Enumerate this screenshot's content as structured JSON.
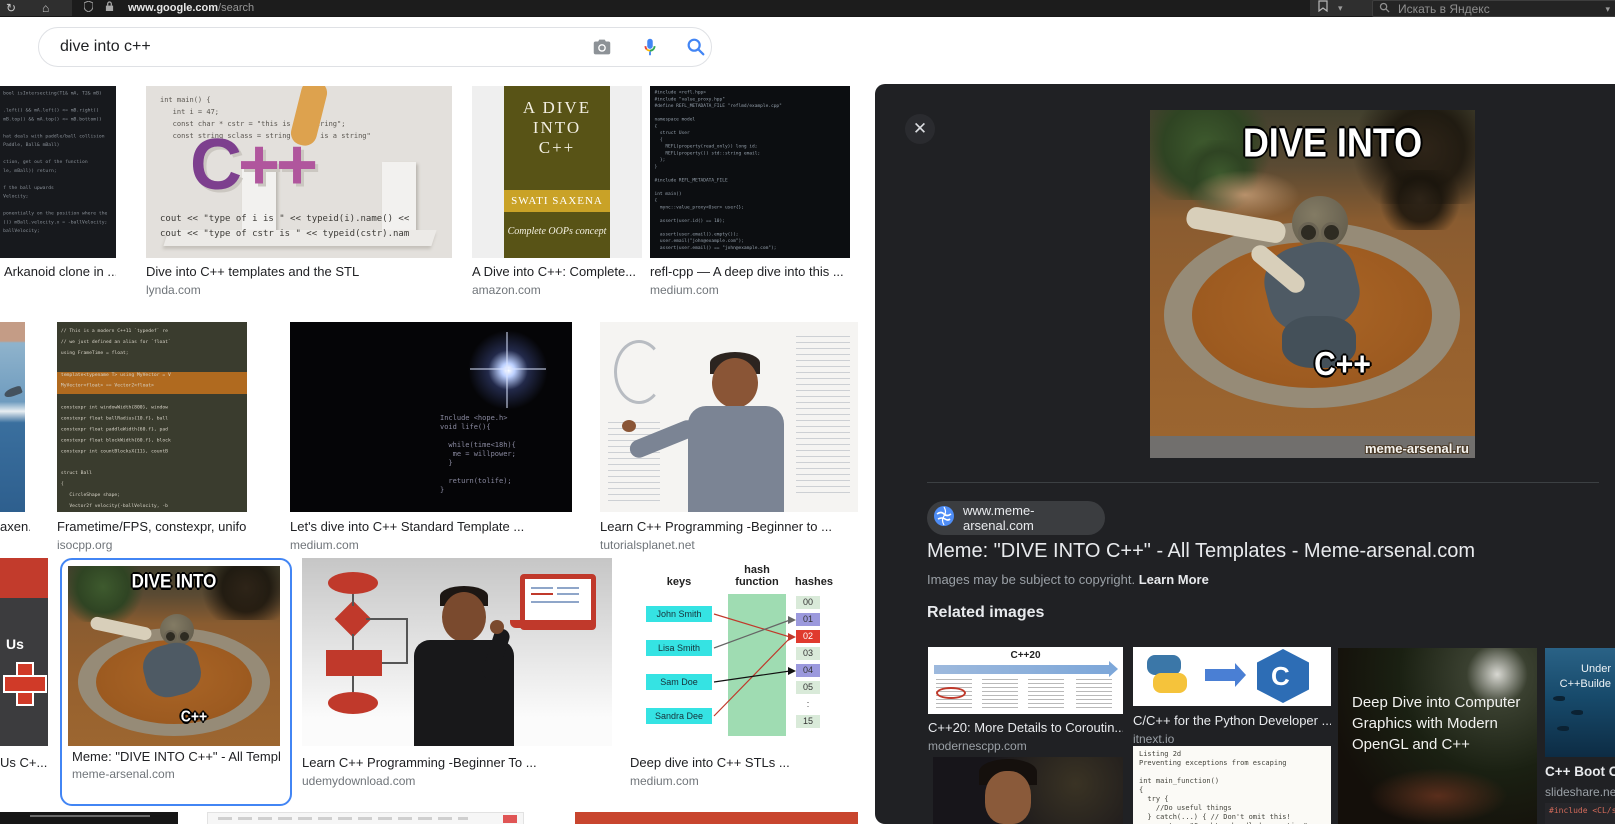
{
  "browser": {
    "url_host": "www.google.com",
    "url_path": "/search",
    "yandex_placeholder": "Искать в Яндекс"
  },
  "search": {
    "query": "dive into c++"
  },
  "results": [
    {
      "title": "Arkanoid clone in ...",
      "domain": ""
    },
    {
      "title": "Dive into C++ templates and the STL",
      "domain": "lynda.com"
    },
    {
      "title": "A Dive into C++: Complete...",
      "domain": "amazon.com"
    },
    {
      "title": "refl-cpp — A deep dive into this ...",
      "domain": "medium.com"
    },
    {
      "title": "axen...",
      "domain": ""
    },
    {
      "title": "Frametime/FPS, constexpr, uniform ...",
      "domain": "isocpp.org"
    },
    {
      "title": "Let's dive into C++ Standard Template ...",
      "domain": "medium.com"
    },
    {
      "title": "Learn C++ Programming -Beginner to ...",
      "domain": "tutorialsplanet.net"
    },
    {
      "title": "Us C+...",
      "domain": ""
    },
    {
      "title": "Meme: \"DIVE INTO C++\" - All Templat...",
      "domain": "meme-arsenal.com"
    },
    {
      "title": "Learn C++ Programming -Beginner To ...",
      "domain": "udemydownload.com"
    },
    {
      "title": "Deep dive into C++ STLs ...",
      "domain": "medium.com"
    }
  ],
  "thumbs": {
    "arkanoid_code": [
      "bool isIntersecting(T1& mA, T2& mB)",
      "",
      ".left() && mA.left() <= mB.right()",
      "mB.top() && mA.top() <= mB.bottom()",
      "",
      "hat deals with paddle/ball collision",
      "Paddle, Ball& mBall)",
      "",
      "ction, get out of the function",
      "le, mBall)) return;",
      "",
      "f the ball upwards",
      "Velocity;",
      "",
      "ponentially on the position where the",
      "()) mBall.velocity.x = -ballVelocity;",
      "ballVelocity;"
    ],
    "lynda": {
      "code_top": [
        "int main() {",
        "   int i = 47;",
        "   const char * cstr = \"this is a c-string\";",
        "   const string sclass = string(\"this is a string\""
      ],
      "big_text": "C",
      "big_plus": "++",
      "code_bottom": [
        "cout << \"type of i is \" << typeid(i).name() <<",
        "cout << \"type of cstr is \" << typeid(cstr).nam"
      ]
    },
    "book": {
      "title_line1": "A DIVE",
      "title_line2": "INTO",
      "title_line3": "C++",
      "author": "SWATI SAXENA",
      "tagline": "Complete OOPs concept"
    },
    "refl_code": [
      "#include <refl.hpp>",
      "#include \"value_proxy.hpp\"",
      "#define REFL_METADATA_FILE \"reflmd/example.cpp\"",
      "",
      "namespace model",
      "{",
      "  struct User",
      "  {",
      "    REFL(property(read_only)) long id;",
      "    REFL(property()) std::string email;",
      "  };",
      "}",
      "",
      "#include REFL_METADATA_FILE",
      "",
      "int main()",
      "{",
      "  mync::value_proxy<User> user{};",
      "",
      "  assert(user.id() == 10);",
      "",
      "  assert(user.email().empty());",
      "  user.email(\"john@example.com\");",
      "  assert(user.email() == \"john@example.com\");",
      "",
      "  refl::runtime::debug(std::cout, user.target);"
    ],
    "frametime_code": [
      "// This is a modern C++11 `typedef` re",
      "// we just defined an alias for `float`",
      "using FrameTime = float;",
      "",
      "template<typename T> using MyVector = V",
      "MyVector<float> == Vector2<float>",
      "",
      "constexpr int windowWidth{800}, window",
      "constexpr float ballRadius{10.f}, ball",
      "constexpr float paddleWidth{60.f}, pad",
      "constexpr float blockWidth{60.f}, block",
      "constexpr int countBlocksX{11}, countB",
      "",
      "struct Ball",
      "{",
      "   CircleShape shape;",
      "   Vector2f velocity{-ballVelocity, -b"
    ],
    "star_code": [
      "Include <hope.h>",
      "void life(){",
      "",
      "  while(time<18h){",
      "   me = willpower;",
      "  }",
      "",
      "  return(tolife);",
      "}"
    ],
    "hash": {
      "heading_keys": "keys",
      "heading_fn": "hash function",
      "heading_hashes": "hashes",
      "keys": [
        "John Smith",
        "Lisa Smith",
        "Sam Doe",
        "Sandra Dee"
      ],
      "hashes": [
        "00",
        "01",
        "02",
        "03",
        "04",
        "05",
        ":",
        "15"
      ]
    }
  },
  "panel": {
    "meme": {
      "top_text": "DIVE INTO",
      "bottom_text": "C++",
      "watermark": "meme-arsenal.ru"
    },
    "source": "www.meme-arsenal.com",
    "title": "Meme: \"DIVE INTO C++\" - All Templates - Meme-arsenal.com",
    "copyright_text": "Images may be subject to copyright.",
    "learn_more": "Learn More",
    "related_heading": "Related images",
    "related": [
      {
        "title": "C++20: More Details to Coroutin...",
        "domain": "modernescpp.com",
        "thumb_text": "C++20"
      },
      {
        "title": "C/C++ for the Python Developer ...",
        "domain": "itnext.io"
      },
      {
        "overlay": "Deep Dive into Computer\nGraphics with Modern\nOpenGL and C++"
      },
      {
        "title": "C++ Boot Ca",
        "domain": "slideshare.ne",
        "overlay": "Under\nC++Builde"
      },
      {
        "listing": [
          "Listing 2d",
          "Preventing exceptions from escaping",
          "",
          "int main_function()",
          "{",
          "  try {",
          "    //Do useful things",
          "  } catch(...) { // Don't omit this!",
          "    cout << \"Caught unhandled exception\" << endl;"
        ]
      },
      {
        "code": "#include <CL/sy"
      }
    ]
  }
}
